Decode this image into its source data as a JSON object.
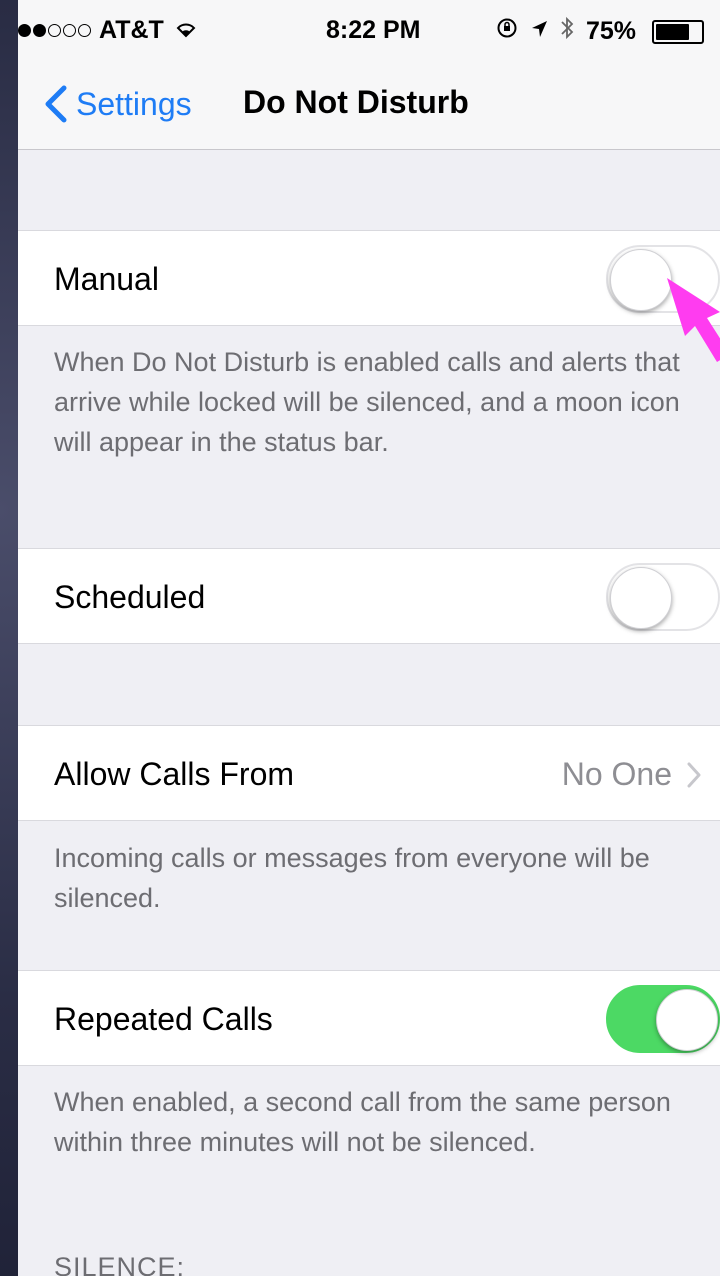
{
  "status_bar": {
    "carrier": "AT&T",
    "time": "8:22 PM",
    "battery": "75%",
    "battery_level": 0.75,
    "signal_bars_filled": 2,
    "signal_bars_total": 5,
    "icons": [
      "wifi-icon",
      "rotation-lock-icon",
      "location-icon",
      "bluetooth-icon",
      "battery-icon"
    ]
  },
  "nav": {
    "back_label": "Settings",
    "title": "Do Not Disturb"
  },
  "manual": {
    "label": "Manual",
    "on": false,
    "footer": "When Do Not Disturb is enabled calls and alerts that arrive while locked will be silenced, and a moon icon will appear in the status bar."
  },
  "scheduled": {
    "label": "Scheduled",
    "on": false
  },
  "allow_calls": {
    "label": "Allow Calls From",
    "value": "No One",
    "footer": "Incoming calls or messages from everyone will be silenced."
  },
  "repeated_calls": {
    "label": "Repeated Calls",
    "on": true,
    "footer": "When enabled, a second call from the same person within three minutes will not be silenced."
  },
  "silence_header": "SILENCE:",
  "colors": {
    "accent": "#1e7cf5",
    "toggle_on": "#4cd964",
    "annotation_arrow": "#ff3cf0",
    "background": "#efeff4"
  }
}
